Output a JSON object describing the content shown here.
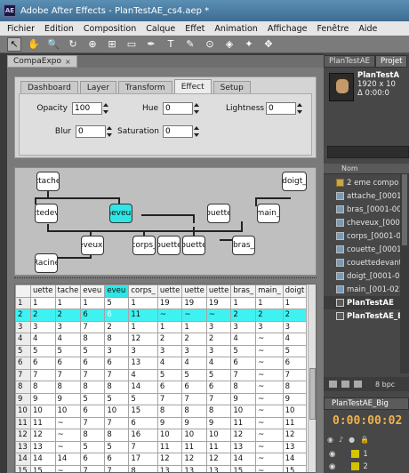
{
  "window": {
    "title": "Adobe After Effects - PlanTestAE_cs4.aep *",
    "logo": "AE"
  },
  "menu": [
    "Fichier",
    "Edition",
    "Composition",
    "Calque",
    "Effet",
    "Animation",
    "Affichage",
    "Fenêtre",
    "Aide"
  ],
  "toolbar": {
    "tools": [
      "selection-tool",
      "hand-tool",
      "zoom-tool",
      "rotate-tool",
      "camera-tool",
      "pan-behind-tool",
      "rectangle-tool",
      "pen-tool",
      "text-tool",
      "brush-tool",
      "clone-stamp-tool",
      "eraser-tool",
      "roto-brush-tool",
      "puppet-pin-tool"
    ],
    "glyphs": [
      "↖",
      "✋",
      "🔍",
      "↻",
      "⊕",
      "⊞",
      "▭",
      "✒",
      "T",
      "✎",
      "⊙",
      "◈",
      "✦",
      "✥"
    ]
  },
  "panel": {
    "tab_label": "CompaExpo",
    "close": "×"
  },
  "tabs": [
    "Dashboard",
    "Layer",
    "Transform",
    "Effect",
    "Setup"
  ],
  "selected_tab": "Effect",
  "fields": {
    "opacity": {
      "label": "Opacity",
      "value": "100"
    },
    "hue": {
      "label": "Hue",
      "value": "0"
    },
    "lightness": {
      "label": "Lightness",
      "value": "0"
    },
    "blur": {
      "label": "Blur",
      "value": "0"
    },
    "saturation": {
      "label": "Saturation",
      "value": "0"
    }
  },
  "tree": {
    "nodes": {
      "attache": "ttache",
      "attachedevant": "ttedev",
      "cheveux": "heveux",
      "sourcils": "eveuxs",
      "corps": "corps_",
      "couette1": "ouette",
      "couette2": "ouette",
      "couette3": "ouette",
      "doigt": "doigt_",
      "main": "main_",
      "bras": "bras_",
      "racine": "Racine"
    }
  },
  "grid": {
    "headers": [
      "uette",
      "tache",
      "eveu",
      "eveu",
      "corps_",
      "uette",
      "uette",
      "uette",
      "bras_",
      "main_",
      "doigt"
    ],
    "rows": [
      [
        "1",
        "1",
        "1",
        "5",
        "1",
        "19",
        "19",
        "19",
        "1",
        "1",
        "1"
      ],
      [
        "2",
        "2",
        "6",
        "6",
        "11",
        "~",
        "~",
        "~",
        "2",
        "2",
        "2"
      ],
      [
        "3",
        "3",
        "7",
        "2",
        "1",
        "1",
        "1",
        "3",
        "3",
        "3",
        "3"
      ],
      [
        "4",
        "4",
        "8",
        "8",
        "12",
        "2",
        "2",
        "2",
        "4",
        "~",
        "4"
      ],
      [
        "5",
        "5",
        "5",
        "3",
        "3",
        "3",
        "3",
        "3",
        "5",
        "~",
        "5"
      ],
      [
        "6",
        "6",
        "6",
        "6",
        "13",
        "4",
        "4",
        "4",
        "6",
        "~",
        "6"
      ],
      [
        "7",
        "7",
        "7",
        "7",
        "4",
        "5",
        "5",
        "5",
        "7",
        "~",
        "7"
      ],
      [
        "8",
        "8",
        "8",
        "8",
        "14",
        "6",
        "6",
        "6",
        "8",
        "~",
        "8"
      ],
      [
        "9",
        "9",
        "5",
        "5",
        "5",
        "7",
        "7",
        "7",
        "9",
        "~",
        "9"
      ],
      [
        "10",
        "10",
        "6",
        "10",
        "15",
        "8",
        "8",
        "8",
        "10",
        "~",
        "10"
      ],
      [
        "11",
        "~",
        "7",
        "7",
        "6",
        "9",
        "9",
        "9",
        "11",
        "~",
        "11"
      ],
      [
        "12",
        "~",
        "8",
        "8",
        "16",
        "10",
        "10",
        "10",
        "12",
        "~",
        "12"
      ],
      [
        "13",
        "~",
        "5",
        "5",
        "7",
        "11",
        "11",
        "11",
        "13",
        "~",
        "13"
      ],
      [
        "14",
        "14",
        "6",
        "6",
        "17",
        "12",
        "12",
        "12",
        "14",
        "~",
        "14"
      ],
      [
        "15",
        "~",
        "7",
        "7",
        "8",
        "13",
        "13",
        "13",
        "15",
        "~",
        "15"
      ]
    ],
    "highlight_row": 2,
    "highlight_col": 4
  },
  "project": {
    "tabs": [
      "PlanTestAE",
      "Projet"
    ],
    "info_name": "PlanTestA",
    "info_size": "1920 x 10",
    "info_dur": "Δ 0:00:0",
    "column": "Nom",
    "items": [
      {
        "label": "2 eme compo",
        "kind": "folder"
      },
      {
        "label": "attache_[0001-00",
        "kind": "footage"
      },
      {
        "label": "bras_[0001-0046",
        "kind": "footage"
      },
      {
        "label": "cheveux_[0001-0",
        "kind": "footage"
      },
      {
        "label": "corps_[0001-002",
        "kind": "footage"
      },
      {
        "label": "couette_[0001-00",
        "kind": "footage"
      },
      {
        "label": "couettedevant_[",
        "kind": "footage"
      },
      {
        "label": "doigt_[0001-002",
        "kind": "footage"
      },
      {
        "label": "main_[001-023].t",
        "kind": "footage"
      },
      {
        "label": "PlanTestAE",
        "kind": "comp"
      },
      {
        "label": "PlanTestAE_Big",
        "kind": "comp"
      }
    ],
    "bpc": "8 bpc"
  },
  "timeline": {
    "tab": "PlanTestAE_Big",
    "timecode": "0:00:00:02",
    "layers": [
      {
        "num": "1",
        "color": "#d4c400"
      },
      {
        "num": "2",
        "color": "#d4c400"
      }
    ]
  },
  "colors": {
    "selection_cyan": "#2ee6e6",
    "timecode_orange": "#f0b24a"
  }
}
